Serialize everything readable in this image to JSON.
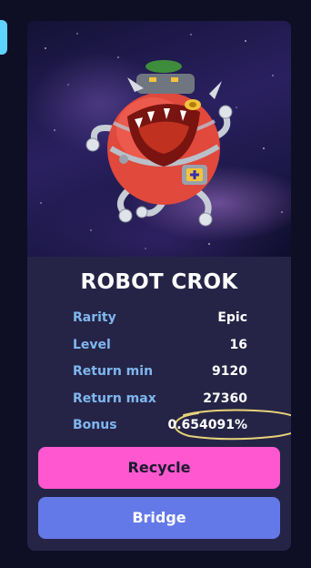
{
  "card": {
    "name": "ROBOT CROK",
    "stats": [
      {
        "label": "Rarity",
        "value": "Epic"
      },
      {
        "label": "Level",
        "value": "16"
      },
      {
        "label": "Return min",
        "value": "9120"
      },
      {
        "label": "Return max",
        "value": "27360"
      },
      {
        "label": "Bonus",
        "value": "0.654091%"
      }
    ],
    "actions": {
      "recycle_label": "Recycle",
      "bridge_label": "Bridge"
    }
  },
  "colors": {
    "page_bg": "#0e0e24",
    "card_bg": "#262446",
    "stat_label": "#7fb7ef",
    "recycle_button": "#ff57cf",
    "bridge_button": "#6479e8",
    "bonus_highlight": "#e6d37a"
  }
}
